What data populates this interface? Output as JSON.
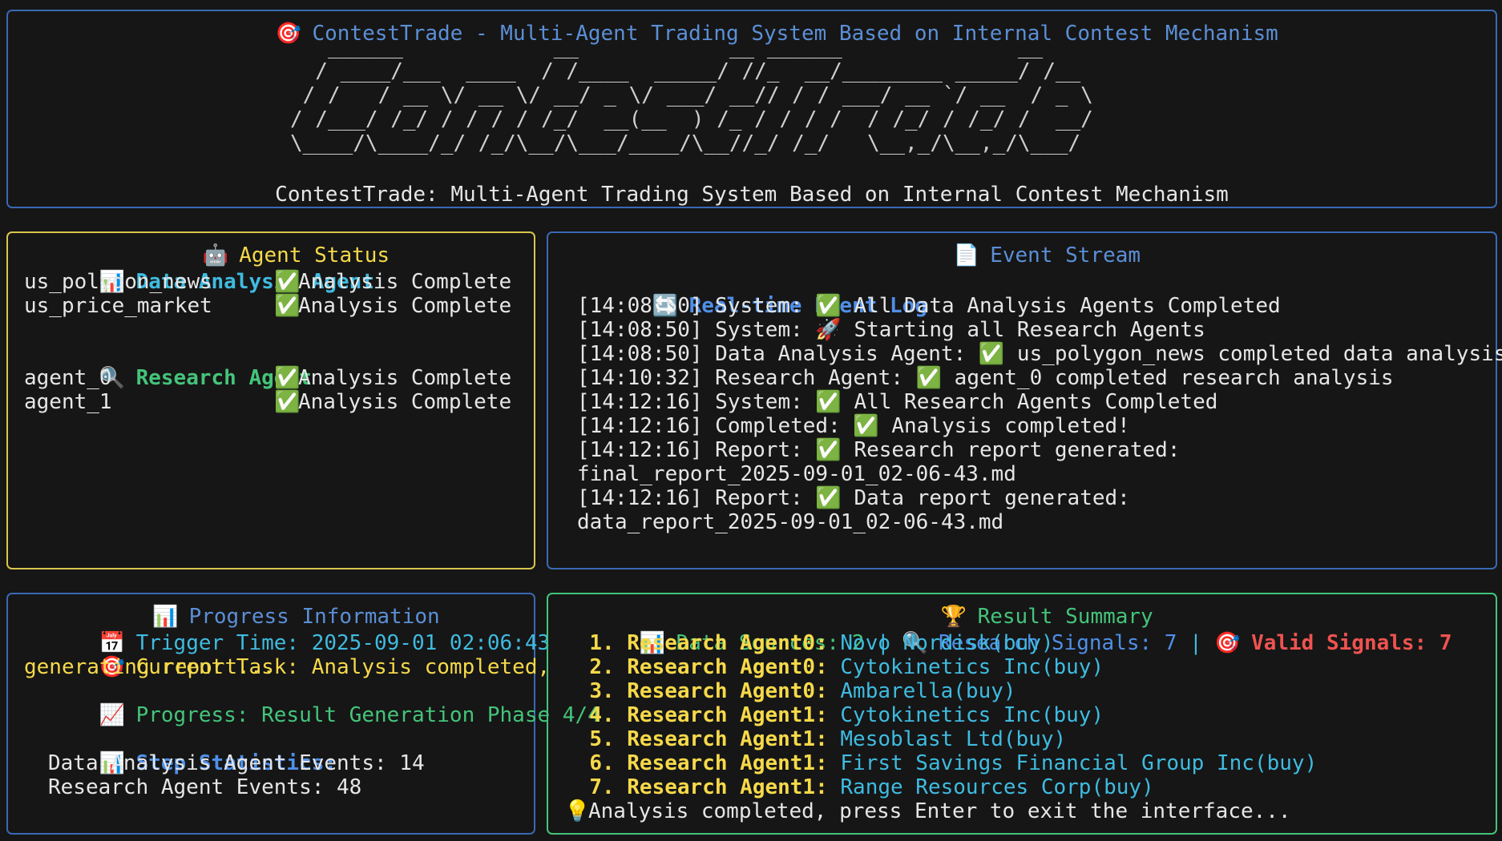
{
  "header": {
    "title": "ContestTrade - Multi-Agent Trading System Based on Internal Contest Mechanism",
    "title_icon": "🎯",
    "ascii_logo": "   ______            __            __ ______              __\n  / ____/___  ____  / /____  _____/ //_  __/________ _____/ /__\n / /   / __ \\/ __ \\/ __/ _ \\/ ___/ __// / / ___/ __ `/ __  / _ \\\n/ /___/ /_/ / / / / /_/  __(__  ) /_ / / / /  / /_/ / /_/ /  __/\n\\____/\\____/_/ /_/\\__/\\___/____/\\__//_/ /_/   \\__,_/\\__,_/\\___/",
    "subtitle": "ContestTrade: Multi-Agent Trading System Based on Internal Contest Mechanism"
  },
  "agent_status": {
    "title": "Agent Status",
    "title_icon": "🤖",
    "data_section": {
      "icon": "📊",
      "label": "Data Analysis Agent",
      "rows": [
        {
          "name": "us_polygon_news",
          "status_icon": "✅",
          "status": "Analysis Complete"
        },
        {
          "name": "us_price_market",
          "status_icon": "✅",
          "status": "Analysis Complete"
        }
      ]
    },
    "research_section": {
      "icon": "🔍",
      "label": "Research Agent",
      "rows": [
        {
          "name": "agent_0",
          "status_icon": "✅",
          "status": "Analysis Complete"
        },
        {
          "name": "agent_1",
          "status_icon": "✅",
          "status": "Analysis Complete"
        }
      ]
    }
  },
  "event_stream": {
    "title": "Event Stream",
    "title_icon": "📄",
    "log_title": "Real-time Event Log",
    "log_icon": "🔄",
    "lines": [
      "[14:08:50] System: ✅ All Data Analysis Agents Completed",
      "[14:08:50] System: 🚀 Starting all Research Agents",
      "[14:08:50] Data Analysis Agent: ✅ us_polygon_news completed data analysis",
      "[14:10:32] Research Agent: ✅ agent_0 completed research analysis",
      "[14:12:16] System: ✅ All Research Agents Completed",
      "[14:12:16] Completed: ✅ Analysis completed!",
      "[14:12:16] Report: ✅ Research report generated:",
      "final_report_2025-09-01_02-06-43.md",
      "[14:12:16] Report: ✅ Data report generated:",
      "data_report_2025-09-01_02-06-43.md"
    ]
  },
  "progress": {
    "title": "Progress Information",
    "title_icon": "📊",
    "trigger_icon": "📅",
    "trigger": "Trigger Time: 2025-09-01 02:06:43",
    "task_icon": "🎯",
    "task_line1": "Current Task: Analysis completed,",
    "task_line2": "generating report...",
    "progress_icon": "📈",
    "progress_text": "Progress: Result Generation Phase 4/4",
    "stats_icon": "📊",
    "stats_label": "Step Statistics:",
    "stats": [
      "Data Analysis Agent Events: 14",
      "Research Agent Events: 48"
    ]
  },
  "result": {
    "title": "Result Summary",
    "title_icon": "🏆",
    "summary": {
      "data_icon": "📊",
      "data_sources": "Data Sources: 2",
      "sep1": " | ",
      "signals_icon": "🔍",
      "research_signals": "Research Signals: 7",
      "sep2": " | ",
      "valid_icon": "🎯",
      "valid_signals": "Valid Signals: 7"
    },
    "items": [
      {
        "num": "1.",
        "agent": "Research Agent0:",
        "signal": "Novo Nordisk(buy)"
      },
      {
        "num": "2.",
        "agent": "Research Agent0:",
        "signal": "Cytokinetics Inc(buy)"
      },
      {
        "num": "3.",
        "agent": "Research Agent0:",
        "signal": "Ambarella(buy)"
      },
      {
        "num": "4.",
        "agent": "Research Agent1:",
        "signal": "Cytokinetics Inc(buy)"
      },
      {
        "num": "5.",
        "agent": "Research Agent1:",
        "signal": "Mesoblast Ltd(buy)"
      },
      {
        "num": "6.",
        "agent": "Research Agent1:",
        "signal": "First Savings Financial Group Inc(buy)"
      },
      {
        "num": "7.",
        "agent": "Research Agent1:",
        "signal": "Range Resources Corp(buy)"
      }
    ],
    "footer_icon": "💡",
    "footer": "Analysis completed, press Enter to exit the interface..."
  },
  "colors": {
    "background": "#161616",
    "blue_border": "#3a68b4",
    "yellow_border": "#d9c64a",
    "green_border": "#44c47a",
    "accent_blue": "#4f8fe8",
    "accent_cyan": "#3fbbe0",
    "accent_green": "#44c47a",
    "accent_yellow": "#f5d94a",
    "accent_red": "#ef5350"
  }
}
